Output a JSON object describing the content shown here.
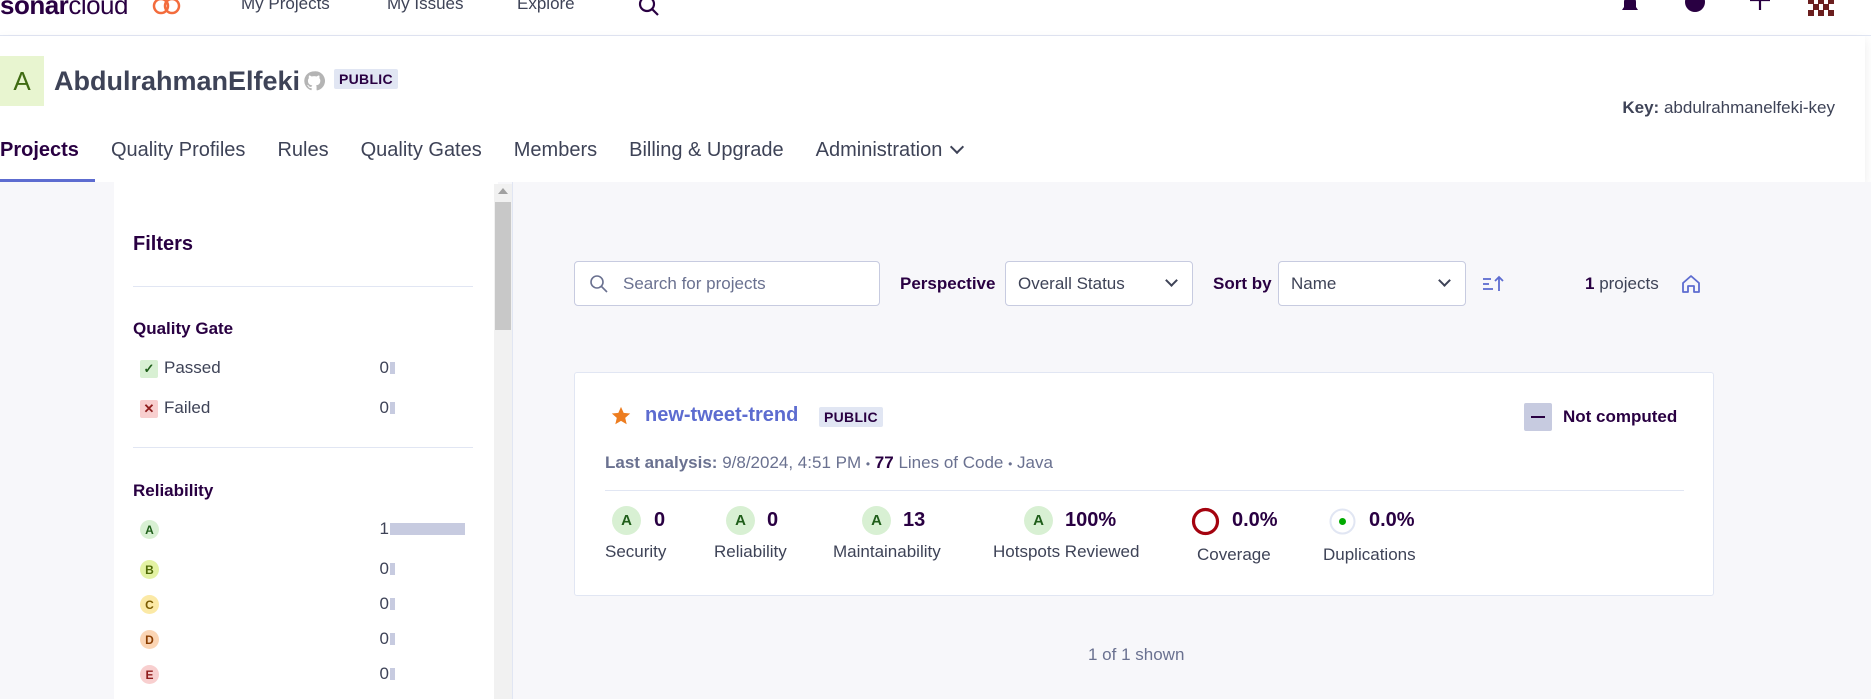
{
  "topnav": {
    "logo_bold": "sonar",
    "logo_light": "cloud",
    "links": [
      "My Projects",
      "My Issues",
      "Explore"
    ],
    "icons": [
      "search-icon",
      "bell-icon",
      "help-icon",
      "plus-icon",
      "user-avatar"
    ]
  },
  "org": {
    "avatar_letter": "A",
    "name": "AbdulrahmanElfeki",
    "visibility": "PUBLIC",
    "key_label": "Key:",
    "key_value": "abdulrahmanelfeki-key"
  },
  "tabs": [
    {
      "label": "Projects",
      "active": true
    },
    {
      "label": "Quality Profiles"
    },
    {
      "label": "Rules"
    },
    {
      "label": "Quality Gates"
    },
    {
      "label": "Members"
    },
    {
      "label": "Billing & Upgrade"
    },
    {
      "label": "Administration"
    }
  ],
  "filters": {
    "title": "Filters",
    "quality_gate": {
      "title": "Quality Gate",
      "items": [
        {
          "label": "Passed",
          "count": "0"
        },
        {
          "label": "Failed",
          "count": "0"
        }
      ]
    },
    "reliability": {
      "title": "Reliability",
      "items": [
        {
          "rating": "A",
          "count": "1"
        },
        {
          "rating": "B",
          "count": "0"
        },
        {
          "rating": "C",
          "count": "0"
        },
        {
          "rating": "D",
          "count": "0"
        },
        {
          "rating": "E",
          "count": "0"
        }
      ]
    }
  },
  "controls": {
    "search_placeholder": "Search for projects",
    "perspective_label": "Perspective",
    "perspective_value": "Overall Status",
    "sort_label": "Sort by",
    "sort_value": "Name",
    "count_num": "1",
    "count_text": " projects"
  },
  "project": {
    "name": "new-tweet-trend",
    "visibility": "PUBLIC",
    "status": "Not computed",
    "analysis_label": "Last analysis:",
    "analysis_date": "9/8/2024, 4:51 PM",
    "sep": "•",
    "loc_value": "77",
    "loc_label": "Lines of Code",
    "language": "Java",
    "metrics": {
      "security": {
        "rating": "A",
        "value": "0",
        "label": "Security"
      },
      "reliability": {
        "rating": "A",
        "value": "0",
        "label": "Reliability"
      },
      "maintainability": {
        "rating": "A",
        "value": "13",
        "label": "Maintainability"
      },
      "hotspots": {
        "rating": "A",
        "value": "100%",
        "label": "Hotspots Reviewed"
      },
      "coverage": {
        "value": "0.0%",
        "label": "Coverage"
      },
      "duplications": {
        "value": "0.0%",
        "label": "Duplications"
      }
    }
  },
  "footer": {
    "shown": "1 of 1 shown"
  },
  "colors": {
    "accent": "#5d6cd0",
    "brand_dark": "#290042",
    "coverage_red": "#a4030f",
    "dup_green": "#00aa00",
    "star": "#ed7d20"
  }
}
